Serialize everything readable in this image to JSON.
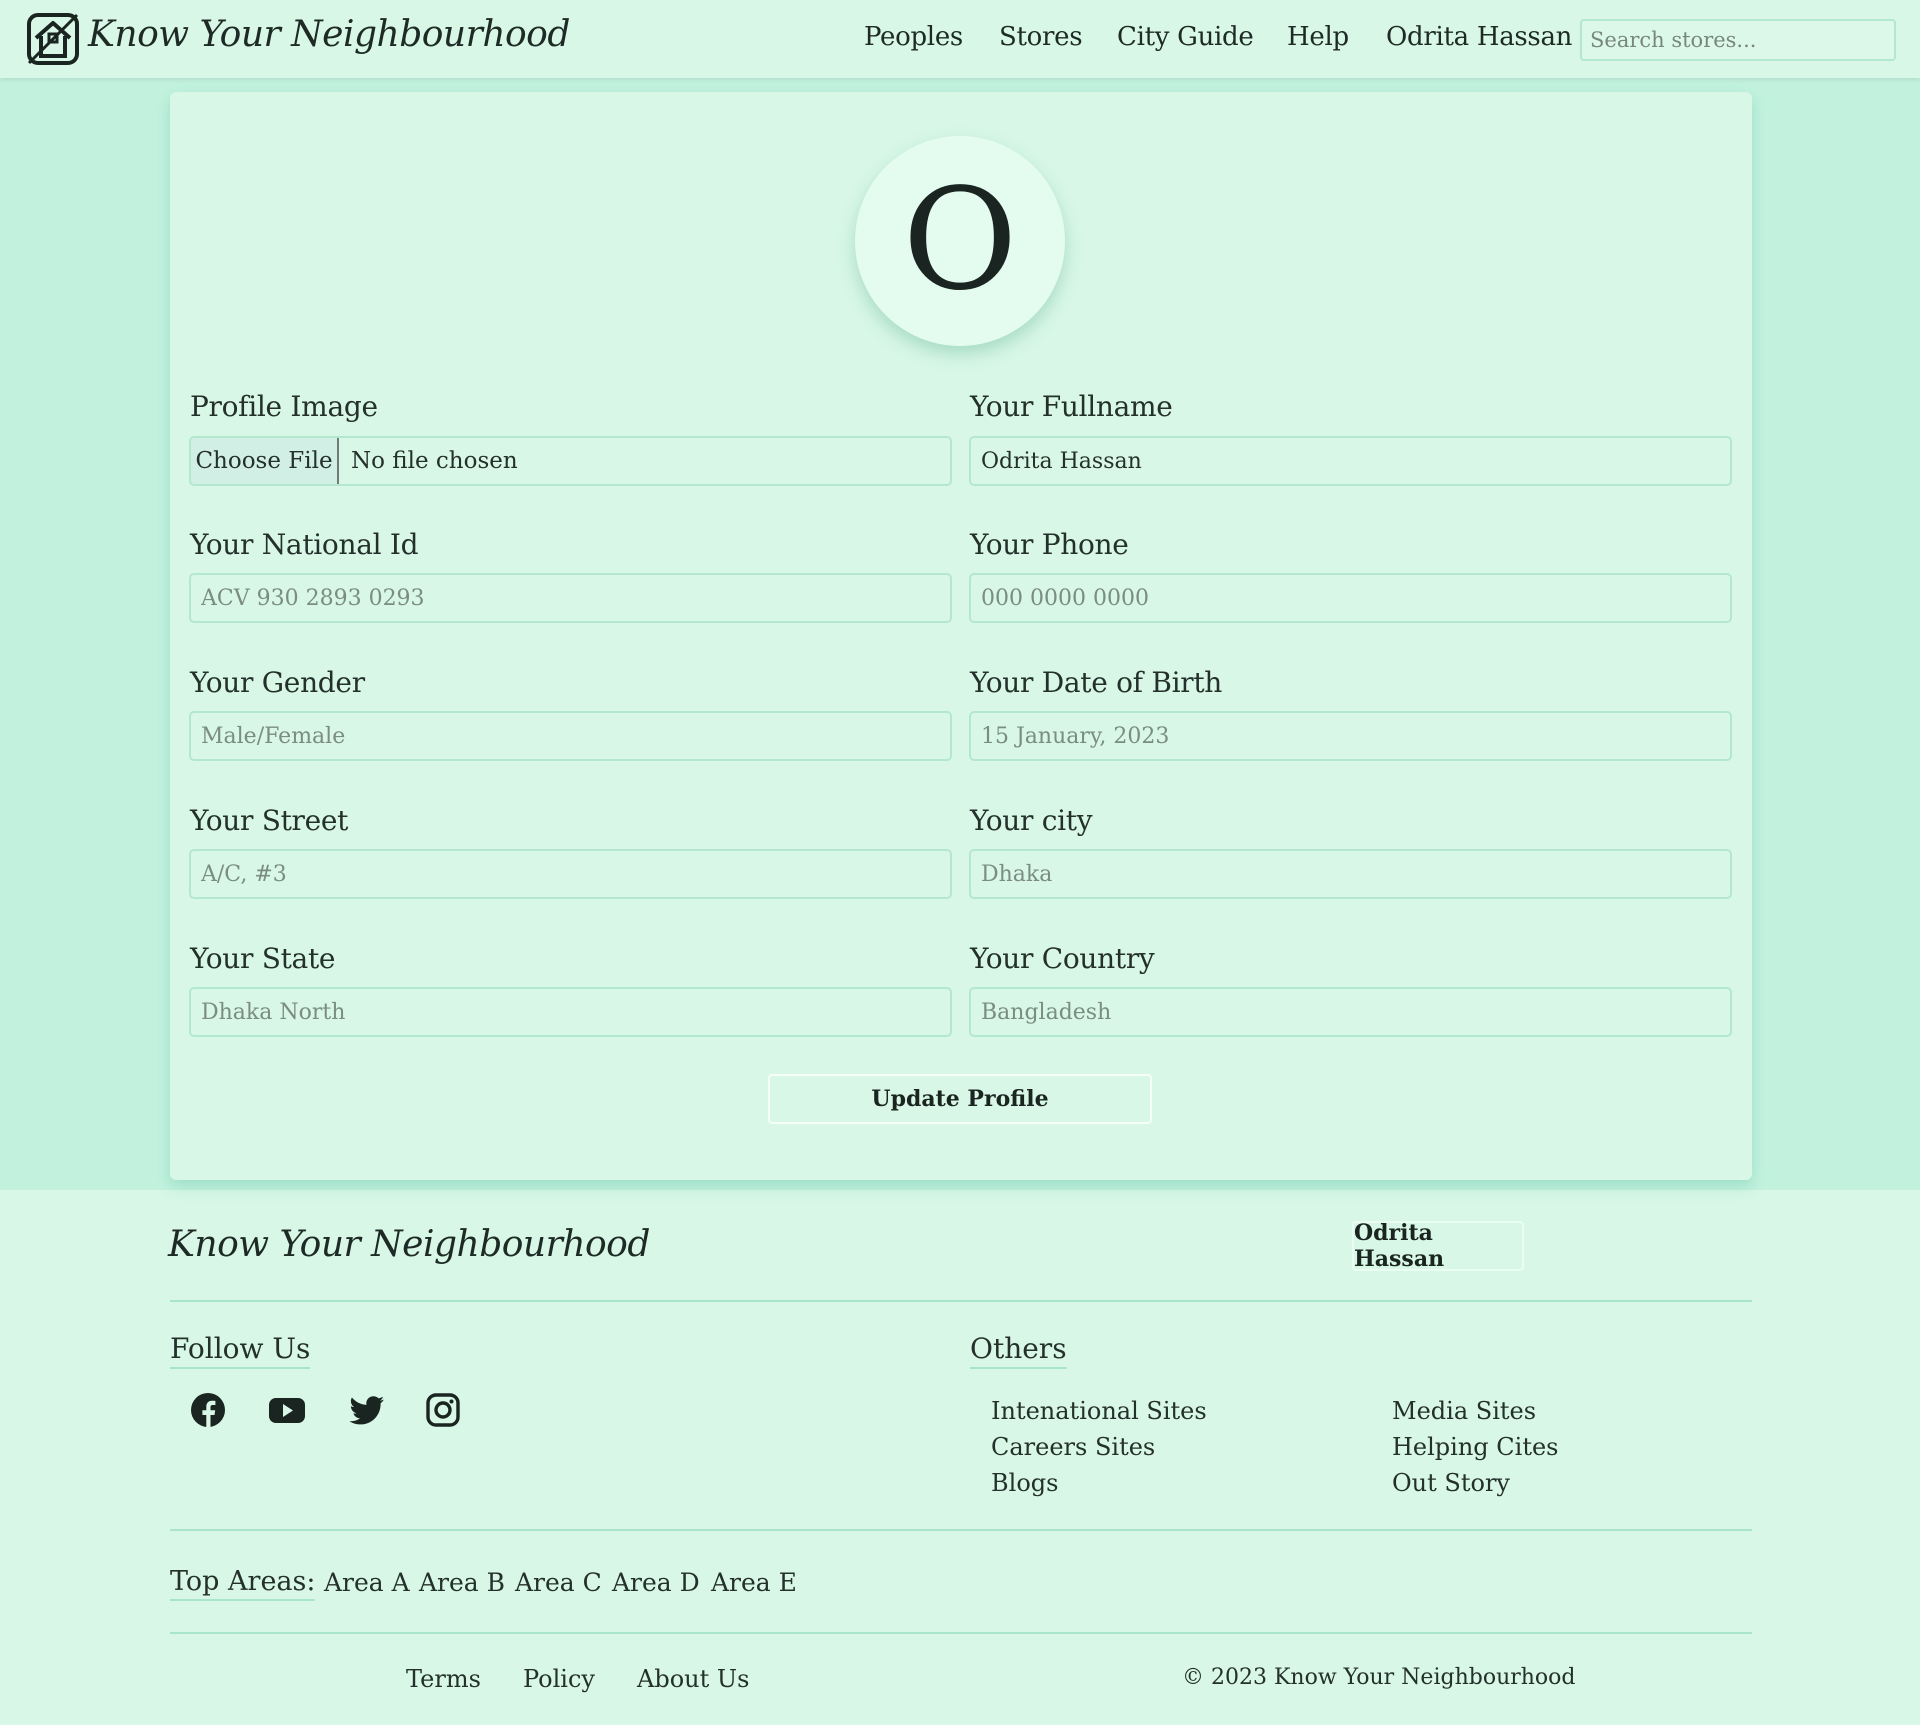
{
  "nav": {
    "brand": "Know Your Neighbourhood",
    "links": [
      "Peoples",
      "Stores",
      "City Guide",
      "Help",
      "Odrita Hassan"
    ],
    "search_placeholder": "Search stores..."
  },
  "profile": {
    "avatar_initial": "O",
    "fields": {
      "profile_image": {
        "label": "Profile Image",
        "button": "Choose File",
        "status": "No file chosen"
      },
      "fullname": {
        "label": "Your Fullname",
        "value": "Odrita Hassan"
      },
      "national_id": {
        "label": "Your National Id",
        "placeholder": "ACV 930 2893 0293"
      },
      "phone": {
        "label": "Your Phone",
        "placeholder": "000 0000 0000"
      },
      "gender": {
        "label": "Your Gender",
        "placeholder": "Male/Female"
      },
      "dob": {
        "label": "Your Date of Birth",
        "placeholder": "15 January, 2023"
      },
      "street": {
        "label": "Your Street",
        "placeholder": "A/C, #3"
      },
      "city": {
        "label": "Your city",
        "placeholder": "Dhaka"
      },
      "state": {
        "label": "Your State",
        "placeholder": "Dhaka North"
      },
      "country": {
        "label": "Your Country",
        "placeholder": "Bangladesh"
      }
    },
    "update_button": "Update Profile"
  },
  "footer": {
    "brand": "Know Your Neighbourhood",
    "user_button": "Odrita Hassan",
    "follow_title": "Follow Us",
    "social_icons": [
      "facebook-icon",
      "youtube-icon",
      "twitter-icon",
      "instagram-icon"
    ],
    "others_title": "Others",
    "others_col1": [
      "Intenational Sites",
      "Careers Sites",
      "Blogs"
    ],
    "others_col2": [
      "Media Sites",
      "Helping Cites",
      "Out Story"
    ],
    "top_areas_label": "Top Areas:",
    "areas": [
      "Area A",
      "Area B",
      "Area C",
      "Area D",
      "Area E"
    ],
    "bottom_links": [
      "Terms",
      "Policy",
      "About Us"
    ],
    "copyright": "© 2023 Know Your Neighbourhood"
  },
  "colors": {
    "page_bg": "#d8f7e6",
    "band_bg": "#c2f2de",
    "border": "#b3e8cf",
    "text": "#1d2a26"
  }
}
